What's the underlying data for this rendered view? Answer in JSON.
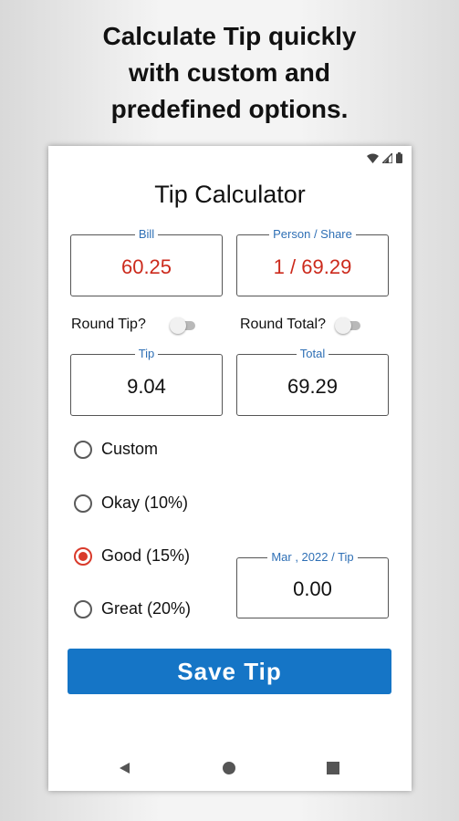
{
  "headline": [
    "Calculate Tip quickly",
    "with custom and",
    "predefined options."
  ],
  "app": {
    "title": "Tip Calculator",
    "bill": {
      "label": "Bill",
      "value": "60.25"
    },
    "share": {
      "label": "Person / Share",
      "value": "1 / 69.29"
    },
    "round_tip": {
      "label": "Round Tip?",
      "on": false
    },
    "round_total": {
      "label": "Round Total?",
      "on": false
    },
    "tip": {
      "label": "Tip",
      "value": "9.04"
    },
    "total": {
      "label": "Total",
      "value": "69.29"
    },
    "options": [
      {
        "label": "Custom",
        "selected": false
      },
      {
        "label": "Okay (10%)",
        "selected": false
      },
      {
        "label": "Good (15%)",
        "selected": true
      },
      {
        "label": "Great (20%)",
        "selected": false
      }
    ],
    "monthly": {
      "label": "Mar , 2022 / Tip",
      "value": "0.00"
    },
    "save_label": "Save Tip"
  },
  "colors": {
    "accent": "#1575c6",
    "label_blue": "#2e6fb5",
    "value_red": "#cc2a1c",
    "radio_red": "#d93a2b"
  },
  "icons": {
    "status": [
      "wifi-icon",
      "cell-signal-icon",
      "battery-icon"
    ],
    "nav": [
      "back-icon",
      "home-icon",
      "recents-icon"
    ]
  }
}
